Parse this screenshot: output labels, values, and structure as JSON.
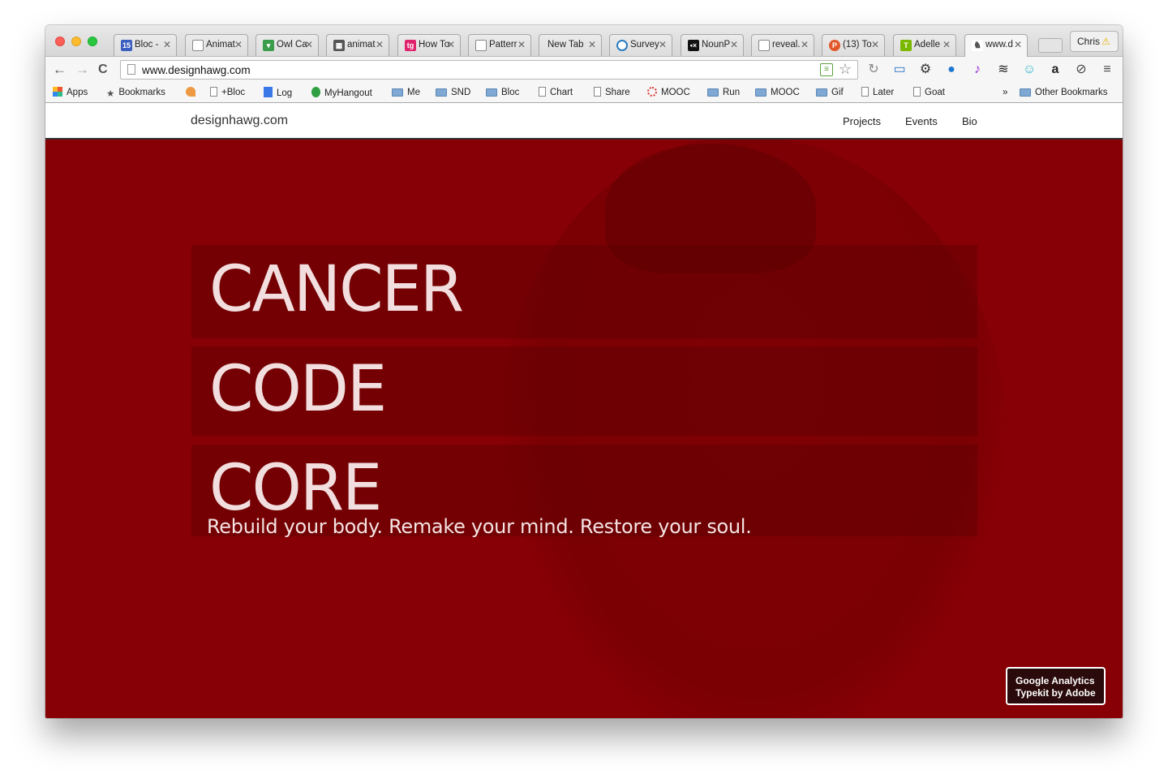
{
  "window": {
    "profile_name": "Chris"
  },
  "tabs": [
    {
      "label": "Bloc -",
      "favicon": "calendar-15-icon",
      "color": "#3b5fc0"
    },
    {
      "label": "Animat",
      "favicon": "page-icon"
    },
    {
      "label": "Owl Ca",
      "favicon": "owl-icon",
      "color": "#3a9d4b"
    },
    {
      "label": "animat",
      "favicon": "film-icon",
      "color": "#555555"
    },
    {
      "label": "How To",
      "favicon": "tg-icon",
      "color": "#e0246c"
    },
    {
      "label": "Patterr",
      "favicon": "page-icon"
    },
    {
      "label": "New Tab",
      "favicon": "none"
    },
    {
      "label": "Survey",
      "favicon": "survey-icon",
      "color": "#2b7bbf"
    },
    {
      "label": "NounP",
      "favicon": "noun-project-icon",
      "color": "#111111"
    },
    {
      "label": "reveal.",
      "favicon": "page-icon"
    },
    {
      "label": "(13) To",
      "favicon": "p-icon",
      "color": "#e2582a"
    },
    {
      "label": "Adelle",
      "favicon": "typekit-icon",
      "color": "#7ab800"
    },
    {
      "label": "www.d",
      "favicon": "designhawg-icon",
      "active": true
    }
  ],
  "toolbar": {
    "back": "←",
    "forward": "→",
    "reload": "C",
    "url": "www.designhawg.com"
  },
  "bookmarks": [
    {
      "label": "Apps",
      "icon": "apps-grid-icon"
    },
    {
      "label": "Bookmarks",
      "icon": "star-icon"
    },
    {
      "label": "",
      "icon": "hangouts-icon"
    },
    {
      "label": "+Bloc",
      "icon": "page-icon"
    },
    {
      "label": "Log",
      "icon": "docs-icon"
    },
    {
      "label": "MyHangout",
      "icon": "evernote-icon"
    },
    {
      "label": "Me",
      "icon": "folder-icon"
    },
    {
      "label": "SND",
      "icon": "folder-icon"
    },
    {
      "label": "Bloc",
      "icon": "folder-icon"
    },
    {
      "label": "Chart",
      "icon": "page-icon"
    },
    {
      "label": "Share",
      "icon": "page-icon"
    },
    {
      "label": "MOOC",
      "icon": "mooc-circle-icon"
    },
    {
      "label": "Run",
      "icon": "folder-icon"
    },
    {
      "label": "MOOC",
      "icon": "folder-icon"
    },
    {
      "label": "Gif",
      "icon": "folder-icon"
    },
    {
      "label": "Later",
      "icon": "page-icon"
    },
    {
      "label": "Goat",
      "icon": "page-icon"
    }
  ],
  "bookmarks_overflow": "»",
  "other_bookmarks": "Other Bookmarks",
  "site": {
    "brand": "designhawg.com",
    "nav": [
      "Projects",
      "Events",
      "Bio"
    ],
    "headlines": [
      "CANCER",
      "CODE",
      "CORE"
    ],
    "tagline": "Rebuild your body. Remake your mind. Restore your soul.",
    "credits": [
      "Google Analytics",
      "Typekit by Adobe"
    ],
    "hero_color": "#870005"
  }
}
